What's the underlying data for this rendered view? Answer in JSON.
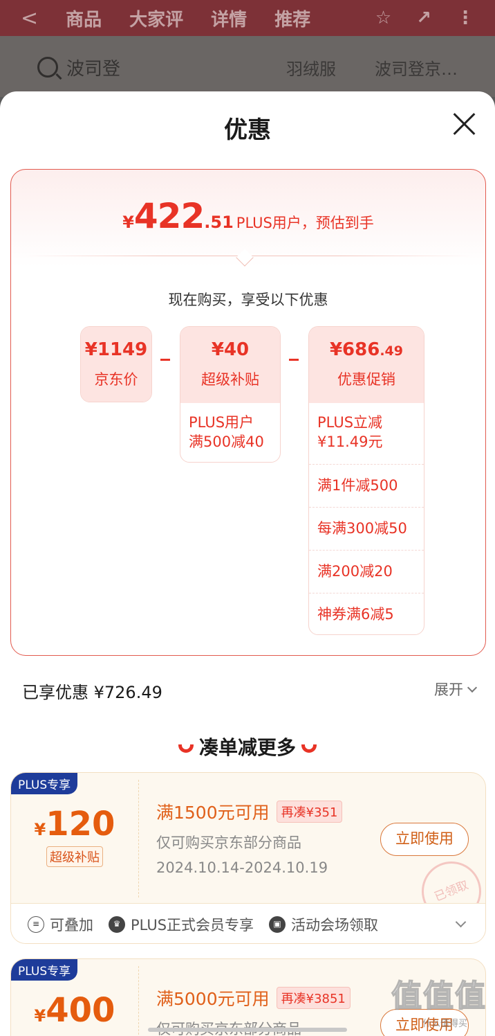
{
  "background_nav": {
    "back_glyph": "<",
    "tabs": [
      "商品",
      "大家评",
      "详情",
      "推荐"
    ]
  },
  "background_search": {
    "query": "波司登",
    "keyword1": "羽绒服",
    "keyword2": "波司登京…"
  },
  "sheet": {
    "title": "优惠"
  },
  "summary": {
    "currency": "¥",
    "price_int": "422",
    "price_dec": ".51",
    "note": "PLUS用户，预估到手",
    "caption": "现在购买，享受以下优惠"
  },
  "breakdown": {
    "jd_price": {
      "amount": "¥1149",
      "label": "京东价"
    },
    "subsidy": {
      "amount": "¥40",
      "label": "超级补贴",
      "details": [
        "PLUS用户\n满500减40"
      ]
    },
    "promo": {
      "amount": "¥686",
      "amount_dec": ".49",
      "label": "优惠促销",
      "details": [
        "PLUS立减\n¥11.49元",
        "满1件减500",
        "每满300减50",
        "满200减20",
        "神券满6减5"
      ]
    }
  },
  "enjoyed": {
    "text": "已享优惠 ¥726.49",
    "expand_label": "展开"
  },
  "more_section": {
    "title": "凑单减更多"
  },
  "coupons": [
    {
      "tag": "PLUS专享",
      "currency": "¥",
      "amount": "120",
      "sub_tag": "超级补贴",
      "condition": "满1500元可用",
      "chip": "再凑¥351",
      "scope": "仅可购买京东部分商品",
      "date": "2024.10.14-2024.10.19",
      "button": "立即使用",
      "stamp": "已领取",
      "features": [
        {
          "icon": "stack-icon",
          "label": "可叠加"
        },
        {
          "icon": "crown-icon",
          "label": "PLUS正式会员专享"
        },
        {
          "icon": "ticket-icon",
          "label": "活动会场领取"
        }
      ]
    },
    {
      "tag": "PLUS专享",
      "currency": "¥",
      "amount": "400",
      "condition": "满5000元可用",
      "chip": "再凑¥3851",
      "scope": "仅可购买京东部分商品",
      "button": "立即使用"
    }
  ],
  "watermark": {
    "text": "值值值",
    "small": "什么值得买"
  },
  "colors": {
    "accent_red": "#e83326",
    "coupon_orange": "#e55c0e",
    "plus_blue": "#1e3c9a"
  }
}
